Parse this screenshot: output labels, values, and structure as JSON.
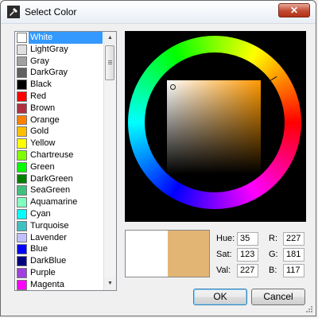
{
  "window": {
    "title": "Select Color",
    "close_label": "✕"
  },
  "colors": [
    {
      "label": "White",
      "swatch": "#ffffff"
    },
    {
      "label": "LightGray",
      "swatch": "#e0e0e0"
    },
    {
      "label": "Gray",
      "swatch": "#a0a0a0"
    },
    {
      "label": "DarkGray",
      "swatch": "#606060"
    },
    {
      "label": "Black",
      "swatch": "#000000"
    },
    {
      "label": "Red",
      "swatch": "#ff0000"
    },
    {
      "label": "Brown",
      "swatch": "#b03040"
    },
    {
      "label": "Orange",
      "swatch": "#ff8000"
    },
    {
      "label": "Gold",
      "swatch": "#ffbf00"
    },
    {
      "label": "Yellow",
      "swatch": "#ffff00"
    },
    {
      "label": "Chartreuse",
      "swatch": "#80ff00"
    },
    {
      "label": "Green",
      "swatch": "#00ff00"
    },
    {
      "label": "DarkGreen",
      "swatch": "#008000"
    },
    {
      "label": "SeaGreen",
      "swatch": "#40c080"
    },
    {
      "label": "Aquamarine",
      "swatch": "#80ffc0"
    },
    {
      "label": "Cyan",
      "swatch": "#00ffff"
    },
    {
      "label": "Turquoise",
      "swatch": "#40c0c0"
    },
    {
      "label": "Lavender",
      "swatch": "#c0c0ff"
    },
    {
      "label": "Blue",
      "swatch": "#0000ff"
    },
    {
      "label": "DarkBlue",
      "swatch": "#000080"
    },
    {
      "label": "Purple",
      "swatch": "#a040e0"
    },
    {
      "label": "Magenta",
      "swatch": "#ff00ff"
    }
  ],
  "selected_color": "White",
  "preview": {
    "old_color": "#ffffff",
    "new_color": "#e3b575"
  },
  "fields": {
    "hue_label": "Hue:",
    "hue": "35",
    "sat_label": "Sat:",
    "sat": "123",
    "val_label": "Val:",
    "val": "227",
    "r_label": "R:",
    "r": "227",
    "g_label": "G:",
    "g": "181",
    "b_label": "B:",
    "b": "117"
  },
  "buttons": {
    "ok": "OK",
    "cancel": "Cancel"
  },
  "icons": {
    "app": "color-picker-icon",
    "close": "close-icon"
  }
}
